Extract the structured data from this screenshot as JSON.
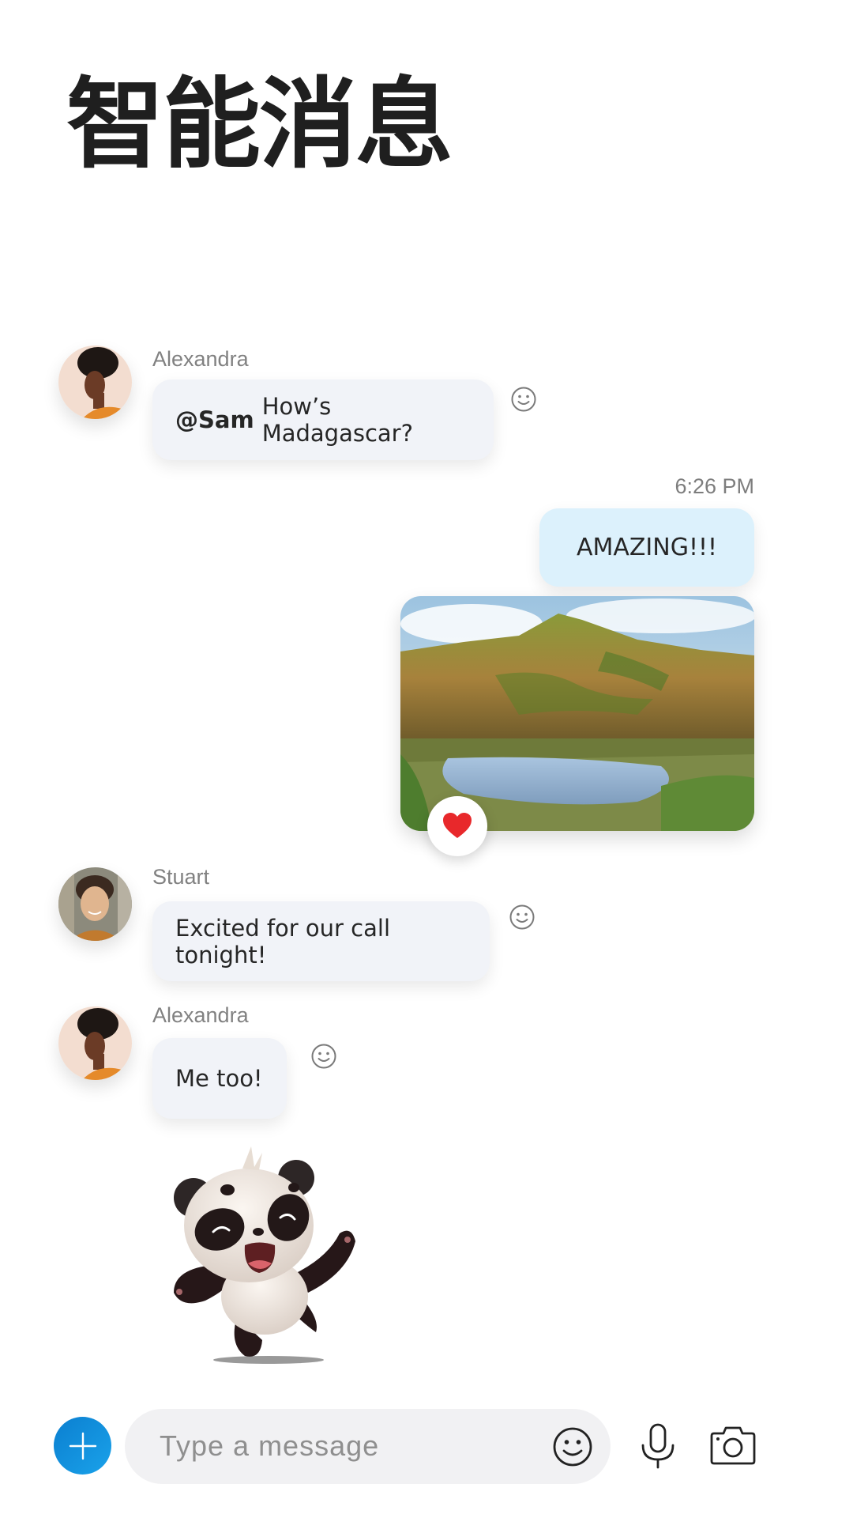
{
  "header": {
    "title": "智能消息"
  },
  "messages": [
    {
      "type": "text",
      "sender": "Alexandra",
      "mention": "@Sam",
      "text": "How’s Madagascar?",
      "reaction_icon": "smiley-add-reaction-icon"
    },
    {
      "type": "text",
      "own": true,
      "timestamp": "6:26 PM",
      "text": "AMAZING!!!"
    },
    {
      "type": "image",
      "own": true,
      "image_desc": "Madagascar hills and lake landscape",
      "reaction": "heart-icon",
      "reaction_color": "#E8282B"
    },
    {
      "type": "text",
      "sender": "Stuart",
      "text": "Excited for our call tonight!",
      "reaction_icon": "smiley-add-reaction-icon"
    },
    {
      "type": "text",
      "sender": "Alexandra",
      "text": "Me too!",
      "reaction_icon": "smiley-add-reaction-icon"
    },
    {
      "type": "sticker",
      "sender": "Alexandra",
      "sticker": "dancing-panda-sticker"
    }
  ],
  "composer": {
    "placeholder": "Type a message",
    "add_button": "plus-icon",
    "emoji_button": "emoji-icon",
    "mic_button": "microphone-icon",
    "camera_button": "camera-icon",
    "accent_color": "#0F8BDB"
  }
}
